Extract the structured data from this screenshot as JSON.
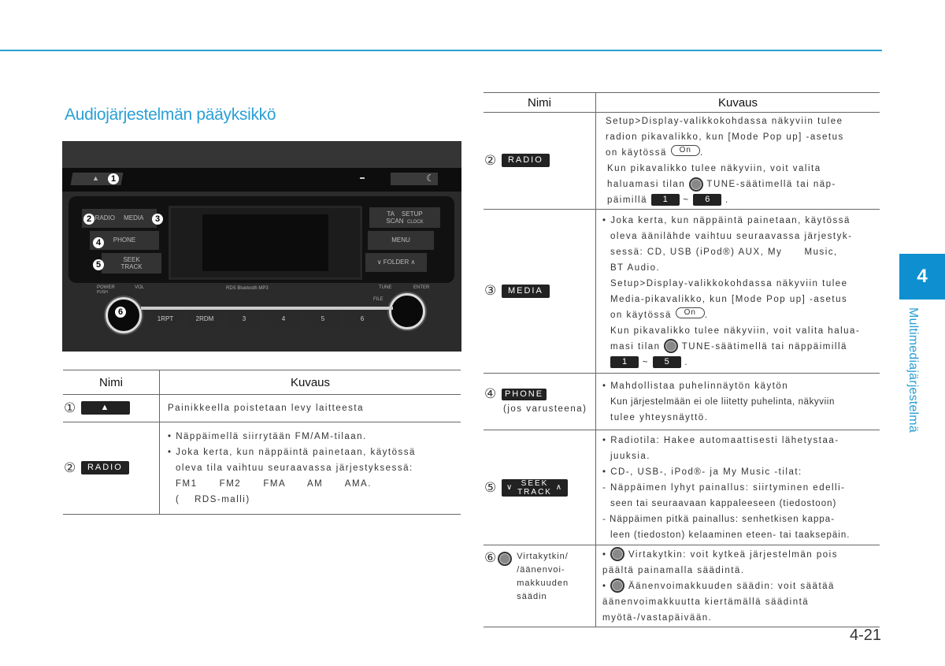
{
  "section_title": "Audiojärjestelmän pääyksikkö",
  "chapter_number": "4",
  "chapter_title": "Multimediajärjestelmä",
  "page_number": "4-21",
  "photo": {
    "callouts": [
      "1",
      "2",
      "3",
      "4",
      "5",
      "6"
    ],
    "labels": {
      "radio": "RADIO",
      "media": "MEDIA",
      "phone": "PHONE",
      "seek": "SEEK",
      "track": "TRACK",
      "ta": "TA",
      "scan": "SCAN",
      "setup": "SETUP",
      "clock": "CLOCK",
      "menu": "MENU",
      "folder": "FOLDER",
      "power": "POWER",
      "push": "PUSH",
      "vol": "VOL",
      "tune": "TUNE",
      "enter": "ENTER",
      "file": "FILE",
      "logos": "RDS  Bluetooth  MP3",
      "presets": [
        "1RPT",
        "2RDM",
        "3",
        "4",
        "5",
        "6"
      ]
    }
  },
  "left_table": {
    "headers": [
      "Nimi",
      "Kuvaus"
    ],
    "rows": [
      {
        "num": "①",
        "key": "▲",
        "desc": "Painikkeella poistetaan levy laitteesta"
      },
      {
        "num": "②",
        "key": "RADIO",
        "lines": [
          "• Näppäimellä siirrytään FM/AM-tilaan.",
          "• Joka kerta, kun näppäintä painetaan, käytössä",
          "oleva tila vaihtuu seuraavassa järjestyksessä:",
          "FM1      FM2      FMA      AM      AMA.",
          "(    RDS-malli)"
        ]
      }
    ]
  },
  "right_table": {
    "headers": [
      "Nimi",
      "Kuvaus"
    ],
    "radio": {
      "num": "②",
      "key": "RADIO",
      "l1": "Setup>Display-valikkokohdassa näkyviin tulee",
      "l2": "radion pikavalikko, kun [Mode Pop up] -asetus",
      "l3": "on käytössä",
      "on": "On",
      "l4": "Kun pikavalikko tulee näkyviin, voit valita",
      "l5a": "haluamasi tilan",
      "l5b": "TUNE-säätimellä tai näp-",
      "l6": "päimillä",
      "k1": "1",
      "tilde": "~",
      "k2": "6"
    },
    "media": {
      "num": "③",
      "key": "MEDIA",
      "l1": "• Joka kerta, kun näppäintä painetaan, käytössä",
      "l2": "oleva äänilähde vaihtuu seuraavassa järjestyk-",
      "l3": "sessä: CD, USB (iPod®) AUX, My      Music,",
      "l4": "BT Audio.",
      "l5": "Setup>Display-valikkokohdassa näkyviin tulee",
      "l6": "Media-pikavalikko, kun [Mode Pop up] -asetus",
      "l7": "on käytössä",
      "on": "On",
      "l8": "Kun pikavalikko tulee näkyviin, voit valita halua-",
      "l9a": "masi tilan",
      "l9b": "TUNE-säätimellä tai näppäimillä",
      "k1": "1",
      "tilde": "~",
      "k2": "5"
    },
    "phone": {
      "num": "④",
      "key": "PHONE",
      "sub": "(jos varusteena)",
      "l1": "• Mahdollistaa puhelinnäytön käytön",
      "l2": "Kun järjestelmään ei ole liitetty puhelinta, näkyviin",
      "l3": "tulee yhteysnäyttö."
    },
    "seek": {
      "num": "⑤",
      "key_top": "SEEK",
      "key_bottom": "TRACK",
      "down": "∨",
      "up": "∧",
      "lines": [
        "• Radiotila: Hakee automaattisesti lähetystaa-",
        "juuksia.",
        "• CD-, USB-, iPod®- ja My Music -tilat:",
        "- Näppäimen lyhyt painallus: siirtyminen edelli-",
        "seen tai seuraavaan kappaleeseen (tiedostoon)",
        "- Näppäimen pitkä painallus: senhetkisen kappa-",
        "leen (tiedoston) kelaaminen eteen- tai taaksepäin."
      ]
    },
    "power": {
      "num": "⑥",
      "name_lines": [
        "Virtakytkin/",
        "/äänenvoi-",
        "makkuuden",
        "säädin"
      ],
      "l1": "Virtakytkin: voit kytkeä järjestelmän pois",
      "l2": "päältä painamalla säädintä.",
      "l3": "Äänenvoimakkuuden säädin: voit säätää",
      "l4": "äänenvoimakkuutta kiertämällä säädintä",
      "l5": "myötä-/vastapäivään.",
      "bullet": "•"
    }
  }
}
